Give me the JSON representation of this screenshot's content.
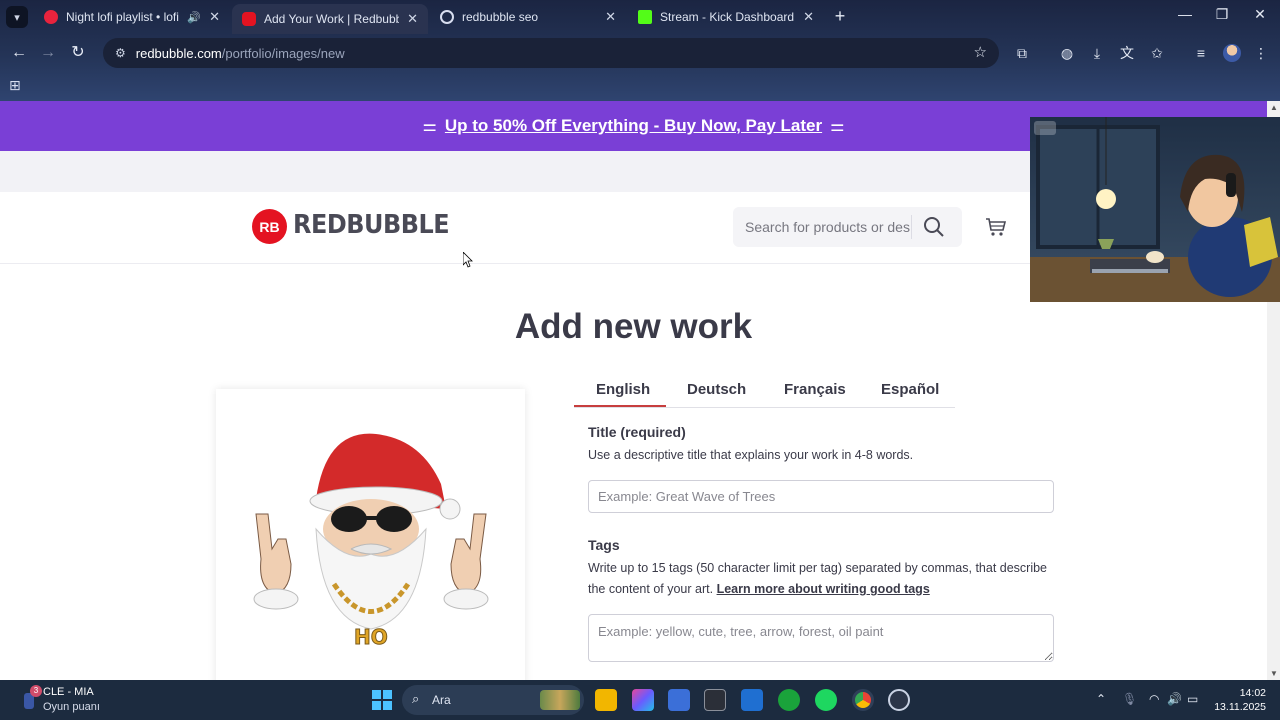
{
  "browser": {
    "tabs": [
      {
        "title": "Night lofi playlist • lofi music",
        "favicon_color": "#e8233d",
        "audible": true,
        "active": false
      },
      {
        "title": "Add Your Work | Redbubble",
        "favicon_color": "#e41321",
        "audible": false,
        "active": true
      },
      {
        "title": "redbubble seo",
        "favicon_color": "#d8def0",
        "audible": false,
        "active": false
      },
      {
        "title": "Stream - Kick Dashboard",
        "favicon_color": "#53fc18",
        "audible": false,
        "active": false
      }
    ],
    "address": {
      "host": "redbubble.com",
      "path": "/portfolio/images/new"
    }
  },
  "promo": {
    "text": "Up to 50% Off Everything - Buy Now, Pay Later",
    "background": "#7a3fd6"
  },
  "header": {
    "brand_mark": "RB",
    "brand": "REDBUBBLE",
    "search_placeholder": "Search for products or designs"
  },
  "main": {
    "title": "Add new work",
    "languages": [
      "English",
      "Deutsch",
      "Français",
      "Español"
    ],
    "active_language": "English",
    "accent": "#c73e3e",
    "title_field": {
      "label": "Title (required)",
      "help": "Use a descriptive title that explains your work in 4-8 words.",
      "placeholder": "Example: Great Wave of Trees"
    },
    "tags_field": {
      "label": "Tags",
      "help": "Write up to 15 tags (50 character limit per tag) separated by commas, that describe the content of your art.",
      "help_link": "Learn more about writing good tags",
      "placeholder": "Example: yellow, cute, tree, arrow, forest, oil paint"
    },
    "artwork": {
      "description_icon": "santa-ho-illustration",
      "chain_text": "HO"
    }
  },
  "taskbar": {
    "weather_badge": "3",
    "match": "CLE - MIA",
    "match_sub": "Oyun puanı",
    "search_placeholder": "Ara",
    "time": "14:02",
    "date": "13.11.2025"
  }
}
